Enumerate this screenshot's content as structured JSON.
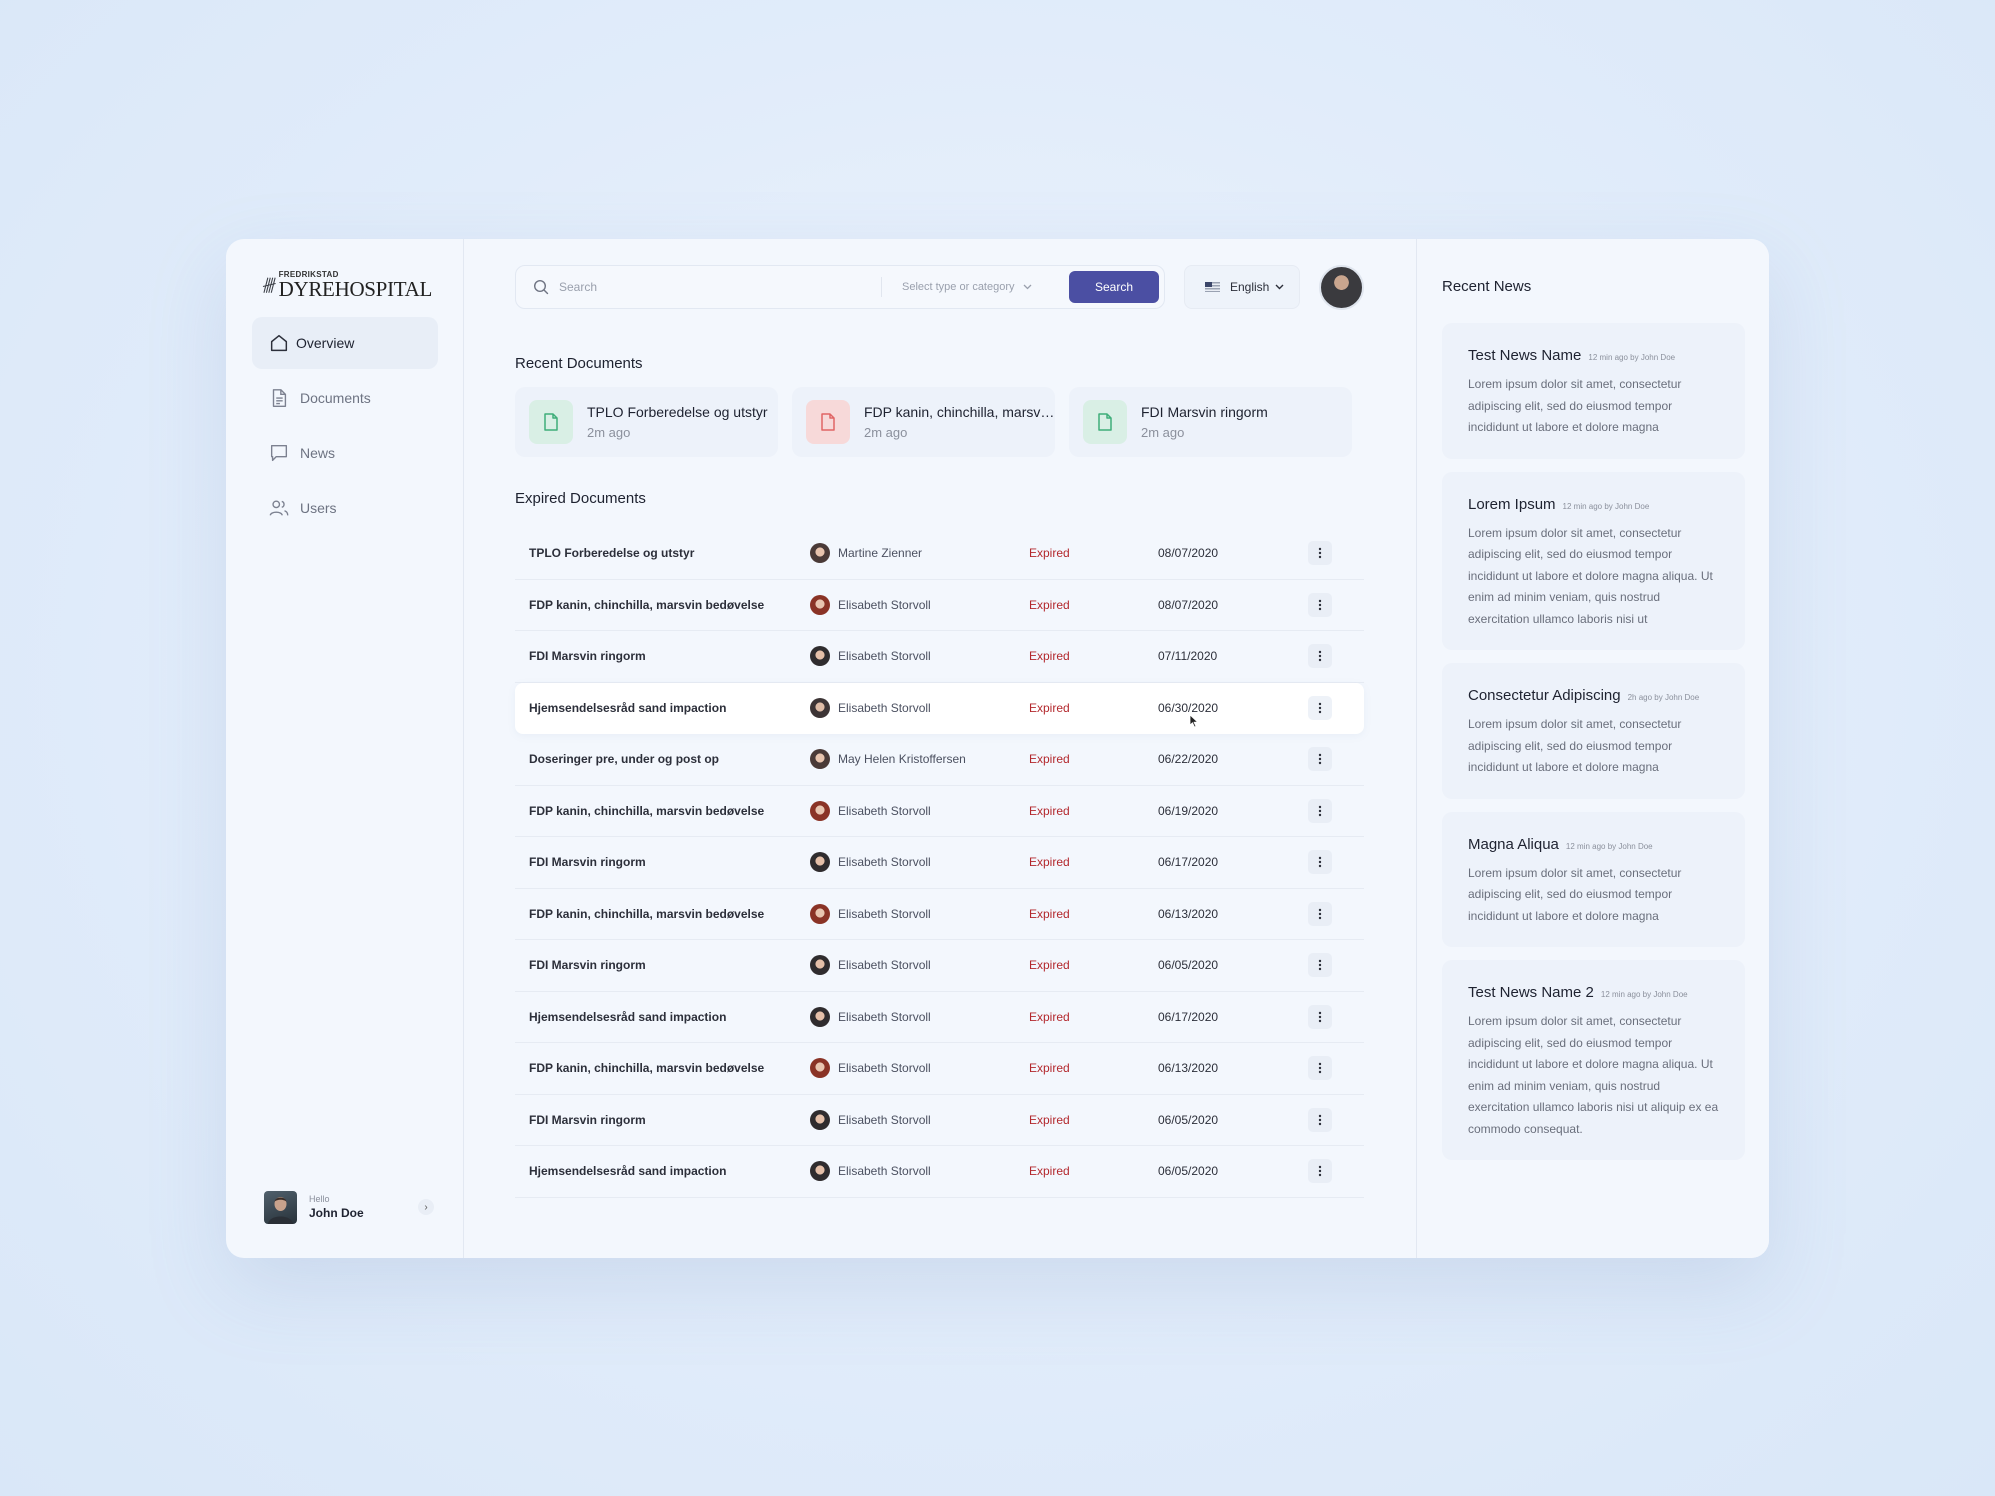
{
  "brand": {
    "logo_small": "FREDRIKSTAD",
    "logo_big": "DYREHOSPITAL"
  },
  "sidebar": {
    "items": [
      {
        "label": "Overview",
        "icon": "home-icon",
        "active": true
      },
      {
        "label": "Documents",
        "icon": "document-icon",
        "active": false
      },
      {
        "label": "News",
        "icon": "chat-icon",
        "active": false
      },
      {
        "label": "Users",
        "icon": "users-icon",
        "active": false
      }
    ],
    "user": {
      "greeting": "Hello",
      "name": "John Doe"
    }
  },
  "search": {
    "placeholder": "Search",
    "category_placeholder": "Select type or category",
    "button_label": "Search"
  },
  "language": {
    "selected": "English"
  },
  "recent_documents": {
    "title": "Recent Documents",
    "items": [
      {
        "title": "TPLO Forberedelse og utstyr",
        "time": "2m ago",
        "color": "#3fae7a"
      },
      {
        "title": "FDP kanin, chinchilla, marsvin bedøvelse",
        "time": "2m ago",
        "color": "#e06565"
      },
      {
        "title": "FDI Marsvin ringorm",
        "time": "2m ago",
        "color": "#3fae7a"
      }
    ]
  },
  "expired_documents": {
    "title": "Expired Documents",
    "rows": [
      {
        "title": "TPLO Forberedelse og utstyr",
        "owner": "Martine Zienner",
        "status": "Expired",
        "date": "08/07/2020"
      },
      {
        "title": "FDP kanin, chinchilla, marsvin bedøvelse",
        "owner": "Elisabeth Storvoll",
        "status": "Expired",
        "date": "08/07/2020"
      },
      {
        "title": "FDI Marsvin ringorm",
        "owner": "Elisabeth Storvoll",
        "status": "Expired",
        "date": "07/11/2020"
      },
      {
        "title": "Hjemsendelsesråd sand impaction",
        "owner": "Elisabeth Storvoll",
        "status": "Expired",
        "date": "06/30/2020"
      },
      {
        "title": "Doseringer pre, under og post op",
        "owner": "May Helen Kristoffersen",
        "status": "Expired",
        "date": "06/22/2020"
      },
      {
        "title": "FDP kanin, chinchilla, marsvin bedøvelse",
        "owner": "Elisabeth Storvoll",
        "status": "Expired",
        "date": "06/19/2020"
      },
      {
        "title": "FDI Marsvin ringorm",
        "owner": "Elisabeth Storvoll",
        "status": "Expired",
        "date": "06/17/2020"
      },
      {
        "title": "FDP kanin, chinchilla, marsvin bedøvelse",
        "owner": "Elisabeth Storvoll",
        "status": "Expired",
        "date": "06/13/2020"
      },
      {
        "title": "FDI Marsvin ringorm",
        "owner": "Elisabeth Storvoll",
        "status": "Expired",
        "date": "06/05/2020"
      },
      {
        "title": "Hjemsendelsesråd sand impaction",
        "owner": "Elisabeth Storvoll",
        "status": "Expired",
        "date": "06/17/2020"
      },
      {
        "title": "FDP kanin, chinchilla, marsvin bedøvelse",
        "owner": "Elisabeth Storvoll",
        "status": "Expired",
        "date": "06/13/2020"
      },
      {
        "title": "FDI Marsvin ringorm",
        "owner": "Elisabeth Storvoll",
        "status": "Expired",
        "date": "06/05/2020"
      },
      {
        "title": "Hjemsendelsesråd sand impaction",
        "owner": "Elisabeth Storvoll",
        "status": "Expired",
        "date": "06/05/2020"
      }
    ]
  },
  "news": {
    "title": "Recent News",
    "items": [
      {
        "name": "Test News Name",
        "meta": "12 min ago by John Doe",
        "body": "Lorem ipsum dolor sit amet, consectetur adipiscing elit, sed do eiusmod tempor incididunt ut labore et dolore magna"
      },
      {
        "name": "Lorem Ipsum",
        "meta": "12 min ago by John Doe",
        "body": "Lorem ipsum dolor sit amet, consectetur adipiscing elit, sed do eiusmod tempor incididunt ut labore et dolore magna aliqua. Ut enim ad minim veniam, quis nostrud exercitation ullamco laboris nisi ut"
      },
      {
        "name": "Consectetur Adipiscing",
        "meta": "2h ago by John Doe",
        "body": "Lorem ipsum dolor sit amet, consectetur adipiscing elit, sed do eiusmod tempor incididunt ut labore et dolore magna"
      },
      {
        "name": "Magna Aliqua",
        "meta": "12 min ago by John Doe",
        "body": "Lorem ipsum dolor sit amet, consectetur adipiscing elit, sed do eiusmod tempor incididunt ut labore et dolore magna"
      },
      {
        "name": "Test News Name 2",
        "meta": "12 min ago by John Doe",
        "body": "Lorem ipsum dolor sit amet, consectetur adipiscing elit, sed do eiusmod tempor incididunt ut labore et dolore magna aliqua. Ut enim ad minim veniam, quis nostrud exercitation ullamco laboris nisi ut aliquip ex ea commodo consequat."
      }
    ]
  },
  "colors": {
    "accent": "#4b4fa3",
    "expired": "#b3282d"
  }
}
